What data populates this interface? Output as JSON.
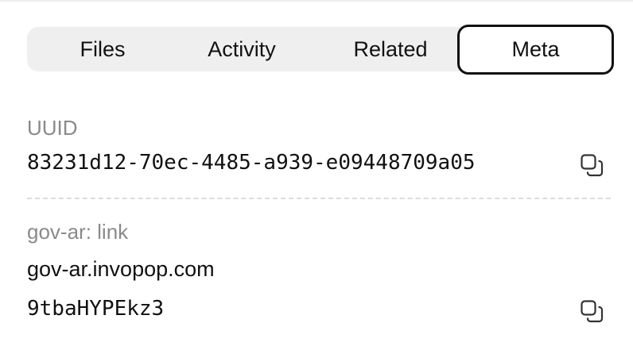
{
  "tabs": {
    "files": "Files",
    "activity": "Activity",
    "related": "Related",
    "meta": "Meta",
    "active": "Meta"
  },
  "uuid": {
    "label": "UUID",
    "value": "83231d12-70ec-4485-a939-e09448709a05",
    "copy_icon": "copy-icon"
  },
  "gov_ar": {
    "label": "gov-ar: link",
    "domain": "gov-ar.invopop.com",
    "code": "9tbaHYPEkz3",
    "copy_icon": "copy-icon"
  },
  "colors": {
    "tab_bg": "#efefef",
    "active_border": "#111111",
    "label_gray": "#8a8a8a",
    "divider": "#dcdcdc"
  }
}
